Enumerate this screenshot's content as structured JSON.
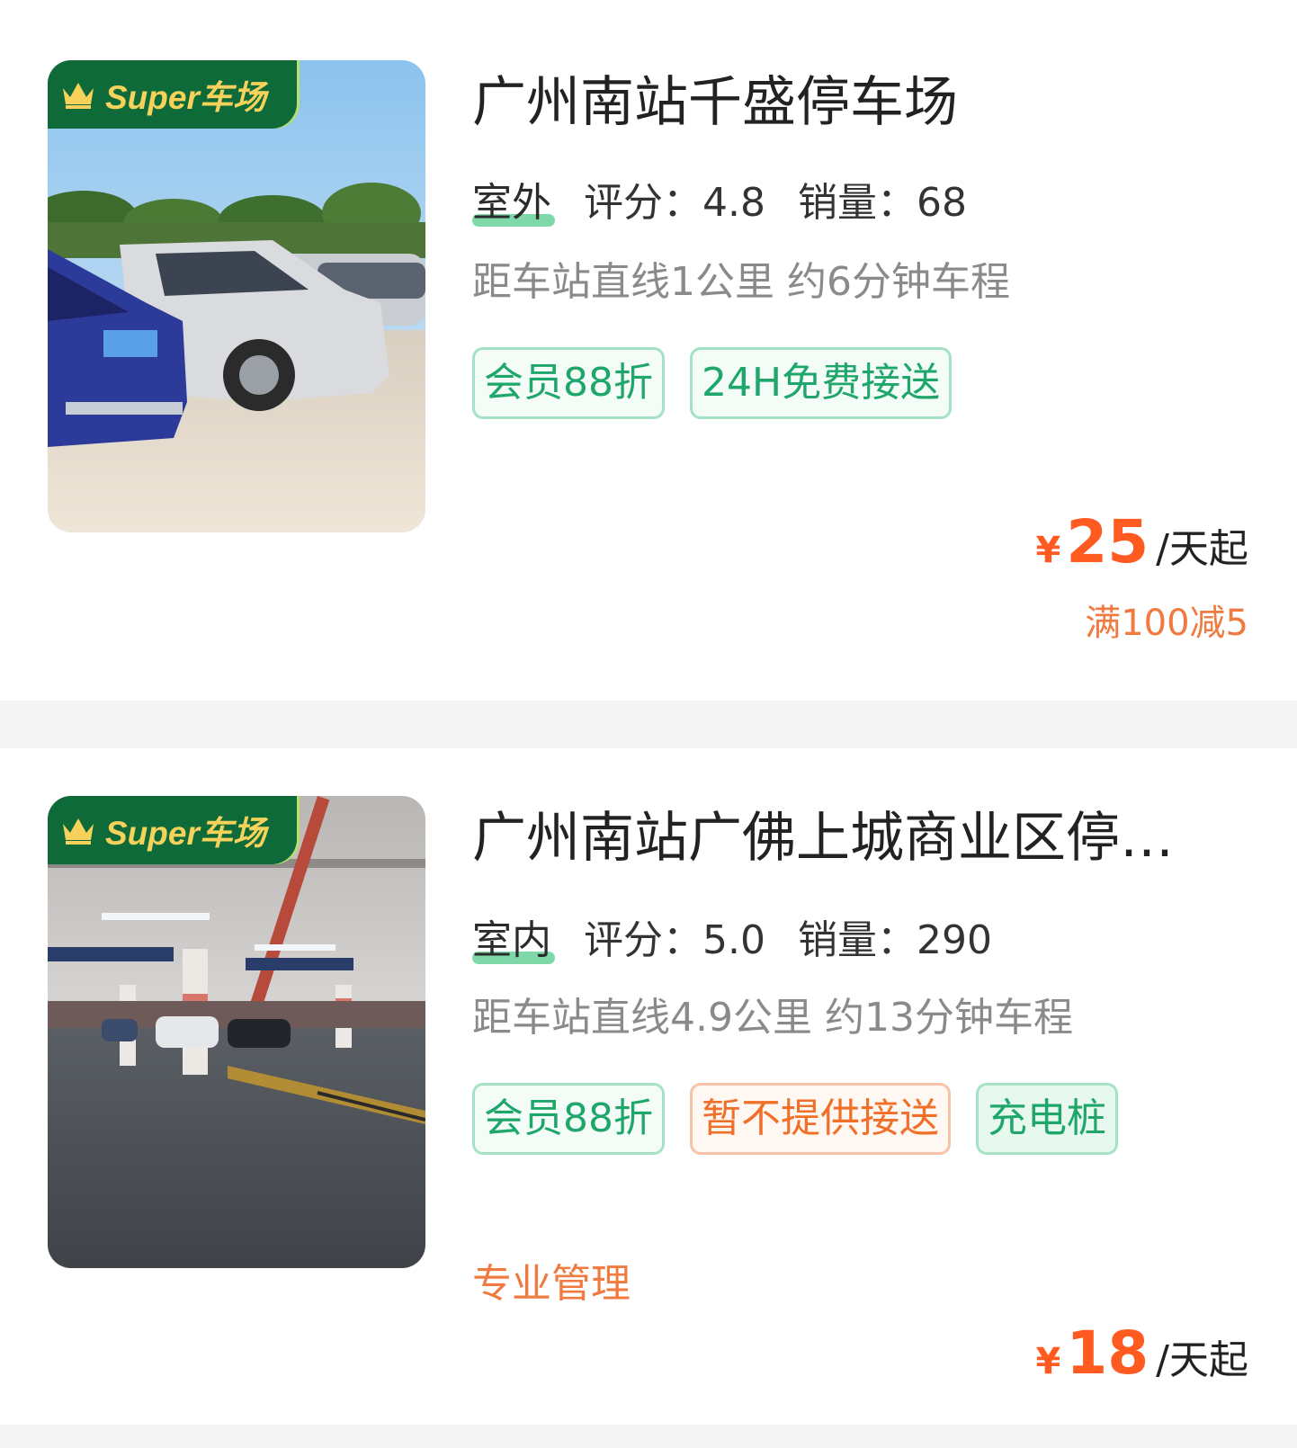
{
  "listings": [
    {
      "badge": "Super车场",
      "title": "广州南站千盛停车场",
      "env": "室外",
      "rating": "评分：4.8",
      "sales": "销量：68",
      "distance": "距车站直线1公里 约6分钟车程",
      "tags": [
        "会员88折",
        "24H免费接送"
      ],
      "currency": "¥",
      "price": "25",
      "unit": "/天起",
      "promo": "满100减5",
      "photo": "outdoor-parking-lot-photo"
    },
    {
      "badge": "Super车场",
      "title": "广州南站广佛上城商业区停…",
      "env": "室内",
      "rating": "评分：5.0",
      "sales": "销量：290",
      "distance": "距车站直线4.9公里 约13分钟车程",
      "tags": [
        "会员88折",
        "暂不提供接送",
        "充电桩"
      ],
      "extra": "专业管理",
      "currency": "¥",
      "price": "18",
      "unit": "/天起",
      "photo": "underground-garage-photo"
    }
  ],
  "colors": {
    "accent_green": "#1fa66a",
    "accent_orange": "#ff5a1f",
    "badge_bg": "#0f6a3a",
    "badge_text": "#f7d25a"
  }
}
